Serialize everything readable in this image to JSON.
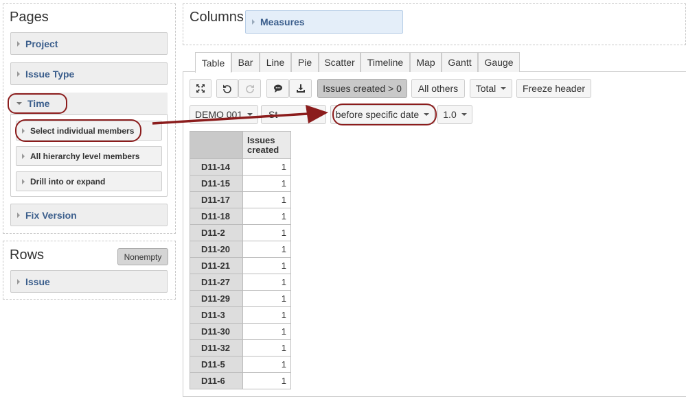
{
  "pages": {
    "title": "Pages",
    "items": [
      "Project",
      "Issue Type",
      "Time",
      "Fix Version"
    ],
    "time_subitems": [
      "Select individual members",
      "All hierarchy level members",
      "Drill into or expand"
    ]
  },
  "rows": {
    "title": "Rows",
    "nonempty_label": "Nonempty",
    "items": [
      "Issue"
    ]
  },
  "columns": {
    "title": "Columns",
    "items": [
      "Measures"
    ]
  },
  "tabs": [
    "Table",
    "Bar",
    "Line",
    "Pie",
    "Scatter",
    "Timeline",
    "Map",
    "Gantt",
    "Gauge"
  ],
  "toolbar": {
    "filter_label": "Issues created > 0",
    "all_others_label": "All others",
    "total_label": "Total",
    "freeze_label": "Freeze header"
  },
  "filters": {
    "demo_label": "DEMO 001",
    "st_label": "St",
    "date_label": "before specific date",
    "version_label": "1.0"
  },
  "table": {
    "column_header": "Issues created",
    "rows": [
      {
        "label": "D11-14",
        "value": "1"
      },
      {
        "label": "D11-15",
        "value": "1"
      },
      {
        "label": "D11-17",
        "value": "1"
      },
      {
        "label": "D11-18",
        "value": "1"
      },
      {
        "label": "D11-2",
        "value": "1"
      },
      {
        "label": "D11-20",
        "value": "1"
      },
      {
        "label": "D11-21",
        "value": "1"
      },
      {
        "label": "D11-27",
        "value": "1"
      },
      {
        "label": "D11-29",
        "value": "1"
      },
      {
        "label": "D11-3",
        "value": "1"
      },
      {
        "label": "D11-30",
        "value": "1"
      },
      {
        "label": "D11-32",
        "value": "1"
      },
      {
        "label": "D11-5",
        "value": "1"
      },
      {
        "label": "D11-6",
        "value": "1"
      }
    ]
  },
  "colors": {
    "accent_link": "#3b5e8c",
    "annotation": "#8b1c1c",
    "measures_bg": "#e4eef9"
  },
  "icons": [
    "fullscreen-icon",
    "undo-icon",
    "redo-icon",
    "comment-icon",
    "download-icon"
  ]
}
